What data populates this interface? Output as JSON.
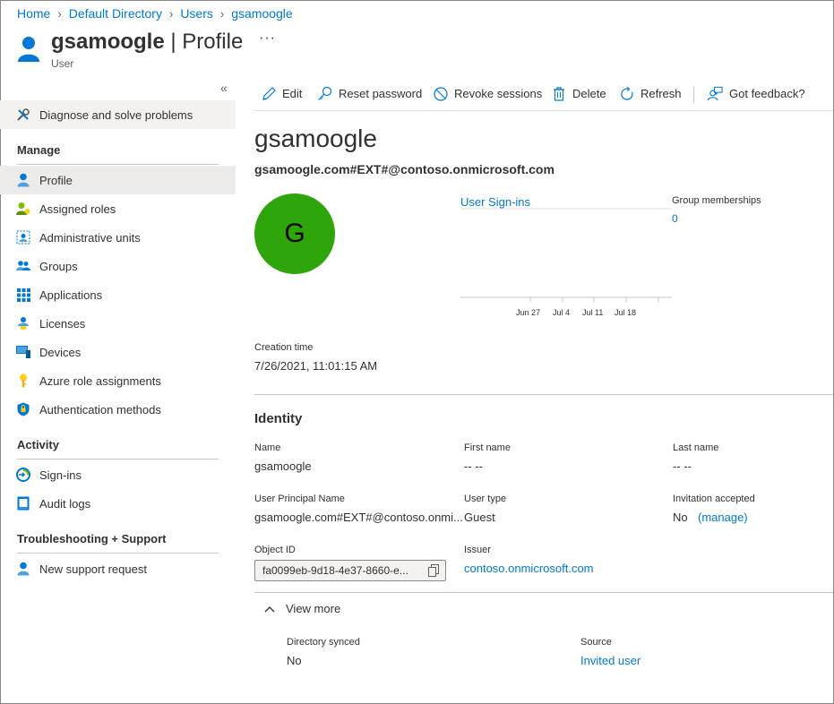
{
  "breadcrumb": {
    "home": "Home",
    "directory": "Default Directory",
    "users": "Users",
    "current": "gsamoogle"
  },
  "header": {
    "name": "gsamoogle",
    "separator": "|",
    "page": "Profile",
    "subtitle": "User",
    "more": "···"
  },
  "sidebar": {
    "collapse": "«",
    "diagnose": "Diagnose and solve problems",
    "manage_heading": "Manage",
    "manage": [
      "Profile",
      "Assigned roles",
      "Administrative units",
      "Groups",
      "Applications",
      "Licenses",
      "Devices",
      "Azure role assignments",
      "Authentication methods"
    ],
    "activity_heading": "Activity",
    "activity": [
      "Sign-ins",
      "Audit logs"
    ],
    "support_heading": "Troubleshooting + Support",
    "support": [
      "New support request"
    ]
  },
  "toolbar": {
    "edit": "Edit",
    "reset_password": "Reset password",
    "revoke_sessions": "Revoke sessions",
    "delete": "Delete",
    "refresh": "Refresh",
    "feedback": "Got feedback?"
  },
  "profile": {
    "display_name": "gsamoogle",
    "upn_heading": "gsamoogle.com#EXT#@contoso.onmicrosoft.com",
    "avatar_initial": "G",
    "avatar_color": "#2ea50a",
    "signins_link": "User Sign-ins",
    "chart_ticks": [
      "Jun 27",
      "Jul 4",
      "Jul 11",
      "Jul 18"
    ],
    "group_memberships_label": "Group memberships",
    "group_memberships_value": "0",
    "creation_time_label": "Creation time",
    "creation_time_value": "7/26/2021, 11:01:15 AM"
  },
  "identity": {
    "title": "Identity",
    "name_label": "Name",
    "name_value": "gsamoogle",
    "first_name_label": "First name",
    "first_name_value": "-- --",
    "last_name_label": "Last name",
    "last_name_value": "-- --",
    "upn_label": "User Principal Name",
    "upn_value": "gsamoogle.com#EXT#@contoso.onmi...",
    "user_type_label": "User type",
    "user_type_value": "Guest",
    "invitation_label": "Invitation accepted",
    "invitation_value": "No",
    "invitation_manage": "(manage)",
    "object_id_label": "Object ID",
    "object_id_value": "fa0099eb-9d18-4e37-8660-e...",
    "issuer_label": "Issuer",
    "issuer_value": "contoso.onmicrosoft.com"
  },
  "view_more": {
    "label": "View more",
    "directory_synced_label": "Directory synced",
    "directory_synced_value": "No",
    "source_label": "Source",
    "source_value": "Invited user"
  },
  "colors": {
    "accent": "#0078d4",
    "selected_bg": "#edebe9"
  }
}
